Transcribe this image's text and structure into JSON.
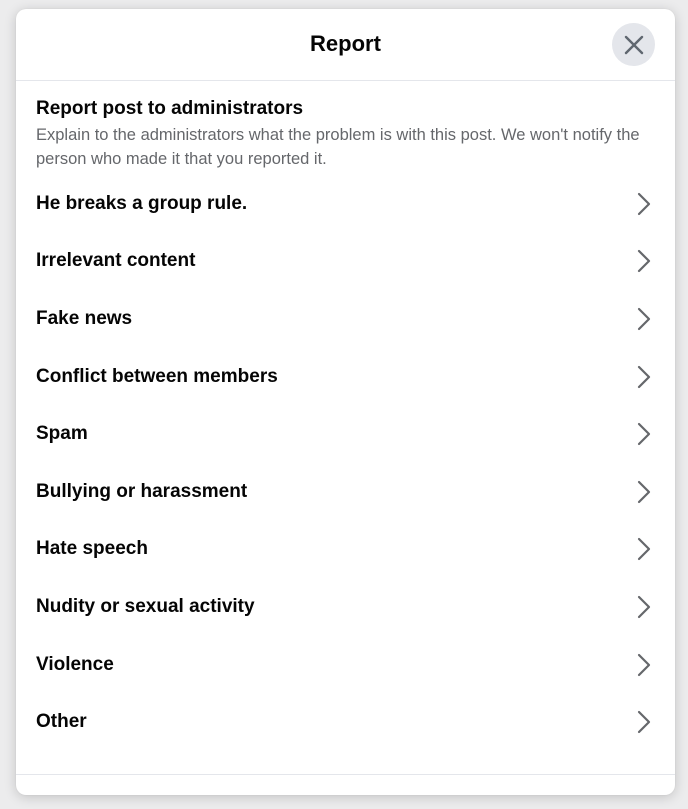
{
  "dialog": {
    "title": "Report",
    "close_icon": "close-icon",
    "intro": {
      "heading": "Report post to administrators",
      "text": "Explain to the administrators what the problem is with this post. We won't notify the person who made it that you reported it."
    },
    "options": [
      {
        "label": "He breaks a group rule.",
        "icon": "chevron-right-icon"
      },
      {
        "label": "Irrelevant content",
        "icon": "chevron-right-icon"
      },
      {
        "label": "Fake news",
        "icon": "chevron-right-icon"
      },
      {
        "label": "Conflict between members",
        "icon": "chevron-right-icon"
      },
      {
        "label": "Spam",
        "icon": "chevron-right-icon"
      },
      {
        "label": "Bullying or harassment",
        "icon": "chevron-right-icon"
      },
      {
        "label": "Hate speech",
        "icon": "chevron-right-icon"
      },
      {
        "label": "Nudity or sexual activity",
        "icon": "chevron-right-icon"
      },
      {
        "label": "Violence",
        "icon": "chevron-right-icon"
      },
      {
        "label": "Other",
        "icon": "chevron-right-icon"
      }
    ]
  },
  "colors": {
    "title_text": "#050505",
    "secondary_text": "#65676b",
    "close_button_bg": "#e4e6eb",
    "divider": "#e4e6eb",
    "overlay_bg": "#ececed"
  }
}
